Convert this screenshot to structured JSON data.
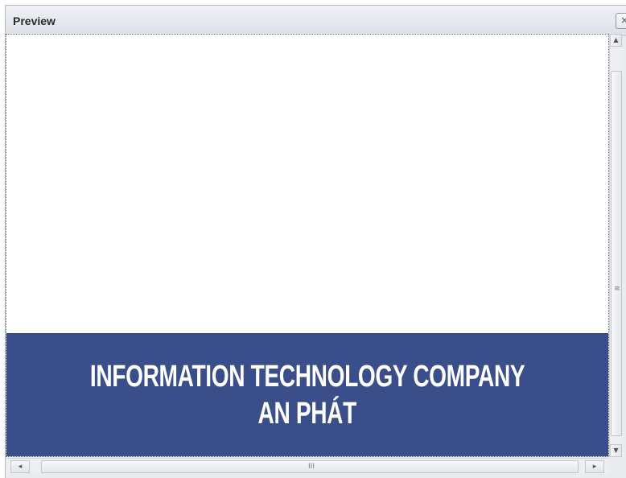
{
  "panel": {
    "title": "Preview",
    "close_glyph": "×"
  },
  "banner": {
    "line1": "INFORMATION TECHNOLOGY COMPANY",
    "line2": "AN PHÁT",
    "background_color": "#3a4f89",
    "text_color": "#ffffff"
  },
  "scrollbars": {
    "up_arrow": "▲",
    "down_arrow": "▼",
    "left_arrow": "◂",
    "right_arrow": "▸",
    "vertical_grip": "≡",
    "horizontal_grip": "III"
  }
}
